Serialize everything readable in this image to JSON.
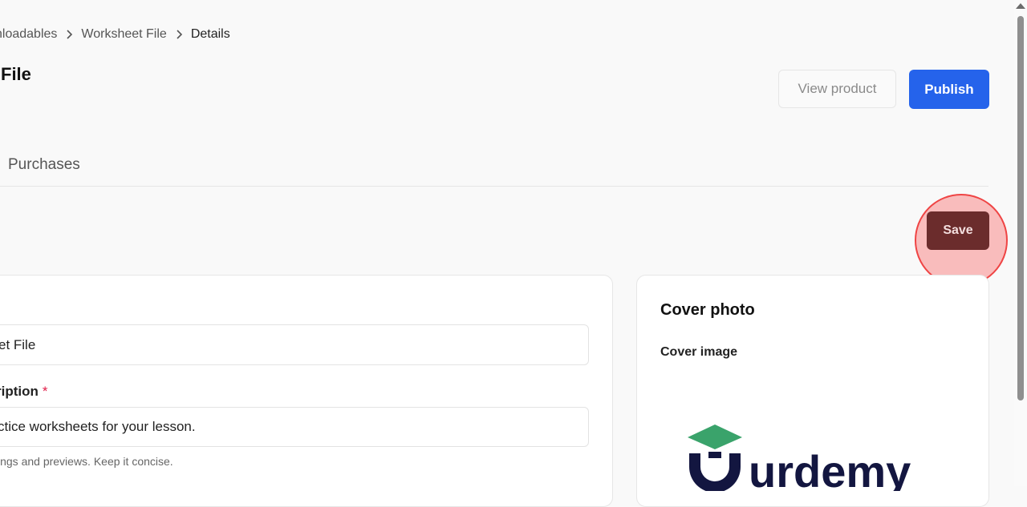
{
  "breadcrumb": {
    "items": [
      "nloadables",
      "Worksheet File",
      "Details"
    ]
  },
  "page": {
    "title": "File"
  },
  "header": {
    "view_product_label": "View product",
    "publish_label": "Publish"
  },
  "tabs": {
    "purchases_label": "Purchases"
  },
  "toolbar": {
    "save_label": "Save"
  },
  "form": {
    "name_value": "et File",
    "description_label": "ription",
    "description_required_mark": "*",
    "description_value": "ctice worksheets for your lesson.",
    "description_help": "ings and previews. Keep it concise."
  },
  "cover": {
    "title": "Cover photo",
    "image_label": "Cover image",
    "logo_text": "urdemy"
  },
  "colors": {
    "primary": "#2563eb",
    "save": "#6b2c2c",
    "highlight": "#ef4444",
    "logo_green": "#3aa36b",
    "logo_navy": "#131640"
  },
  "icons": [
    "chevron-right-icon",
    "scroll-up-icon"
  ]
}
